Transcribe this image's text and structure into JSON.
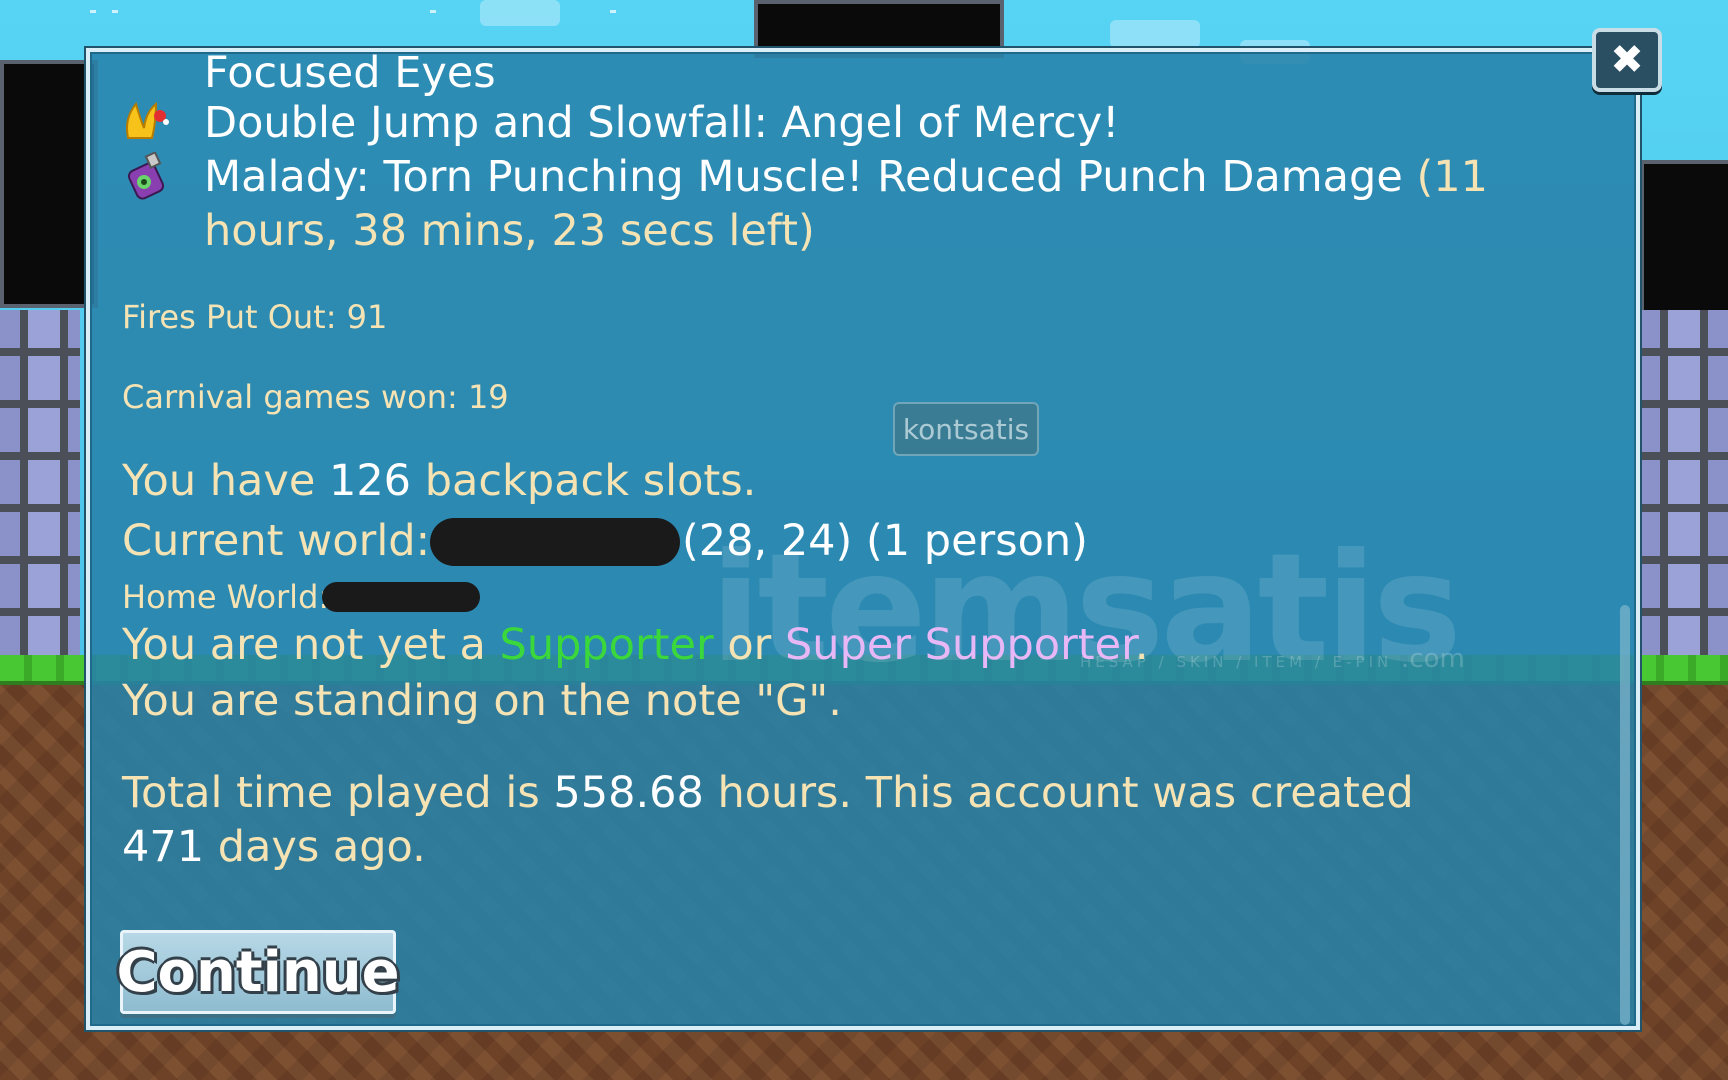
{
  "dialog": {
    "lines": {
      "focused_eyes": "Focused Eyes",
      "double_jump": "Double Jump and Slowfall: Angel of Mercy!",
      "malady_main": "Malady: Torn Punching Muscle! Reduced Punch Damage",
      "malady_time_1": "(11",
      "malady_time_2": "hours, 38 mins, 23 secs left)",
      "fires": "Fires Put Out: 91",
      "carnival": "Carnival games won: 19",
      "backpack_pre": "You have",
      "backpack_num": "126",
      "backpack_post": "backpack slots.",
      "world_label": "Current world:",
      "world_coords": "(28, 24) (1 person)",
      "home_world": "Home World:",
      "supporter_pre": "You are not yet a",
      "supporter": "Supporter",
      "supporter_or": "or",
      "super_supporter": "Super Supporter",
      "supporter_end": ".",
      "note": "You are standing on the note \"G\".",
      "time_pre": "Total time played is",
      "time_hours": "558.68",
      "time_post": "hours.  This account was created",
      "days_num": "471",
      "days_post": "days ago."
    },
    "continue_label": "Continue",
    "close_label": "✖"
  },
  "background": {
    "player_name": "kontsatis",
    "watermark": "itemsatis",
    "watermark_sub": "HESAP / SKIN / ITEM / E-PIN",
    "watermark_com": ".com"
  },
  "colors": {
    "text": "#f5e3b4",
    "highlight": "#ffffff",
    "supporter": "#3ad83a",
    "super_supporter": "#e8b7f6"
  },
  "icons": [
    "angel-wing-icon",
    "malady-bottle-icon",
    "close-icon"
  ]
}
